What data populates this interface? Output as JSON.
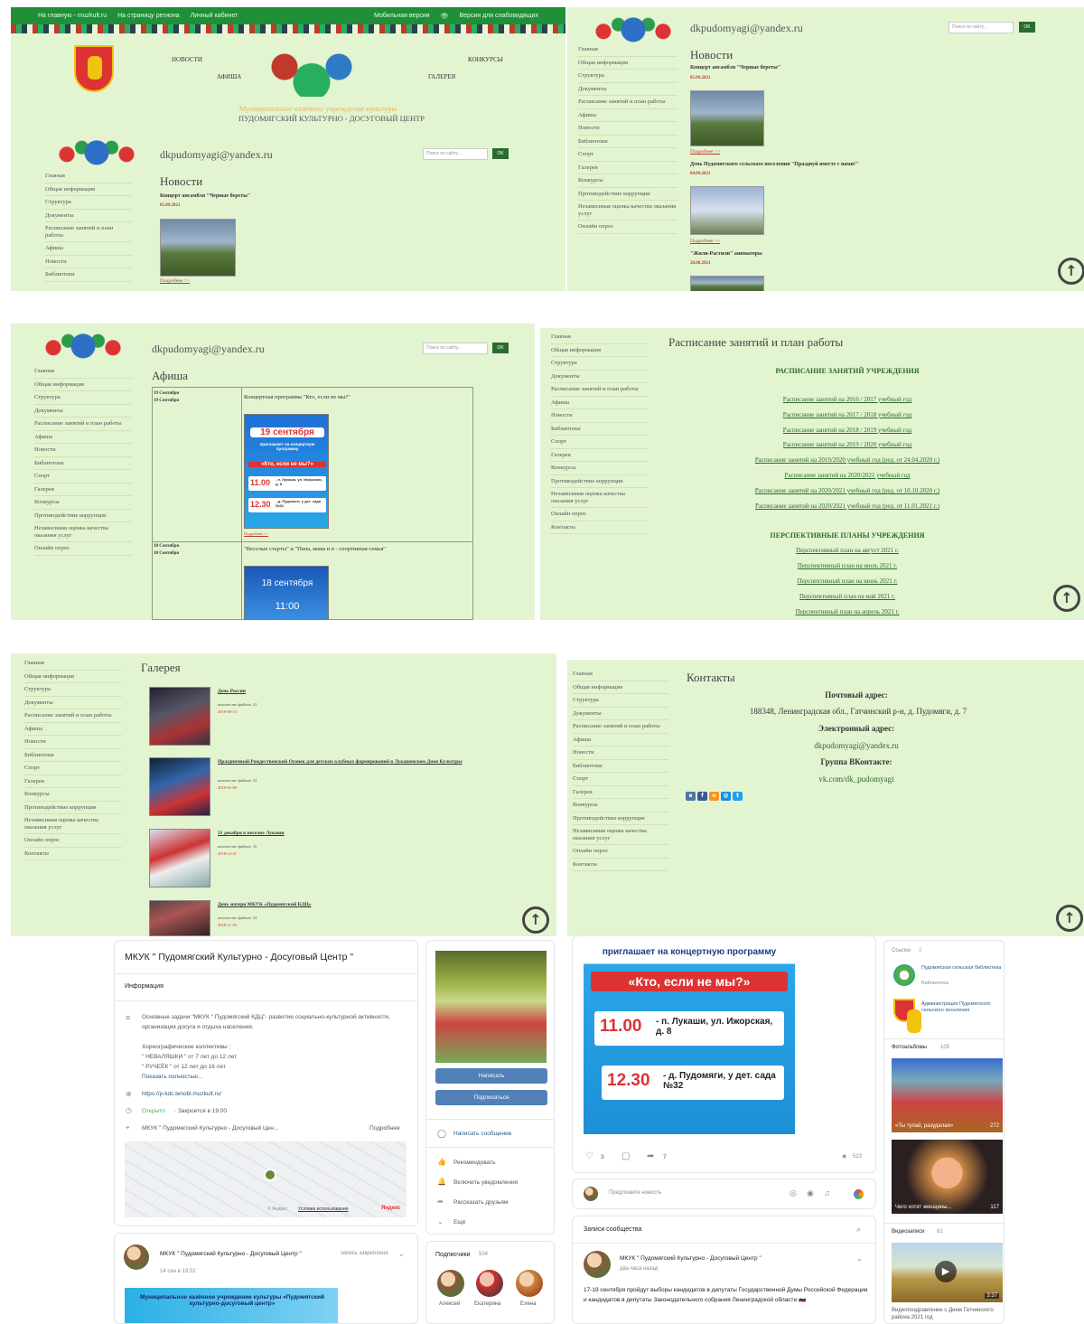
{
  "site": {
    "email": "dkpudomyagi@yandex.ru",
    "search_placeholder": "Поиск по сайту...",
    "ok": "OK",
    "more": "Подробнее >>",
    "org_line1": "Муниципальное казённое учреждение культуры",
    "org_line2": "ПУДОМЯГСКИЙ КУЛЬТУРНО - ДОСУГОВЫЙ ЦЕНТР",
    "topbar": [
      "На главную - muzkult.ru",
      "На страницу региона",
      "Личный кабинет"
    ],
    "topbar_right": [
      "Мобильная версия",
      "Версия для слабовидящих"
    ],
    "nav": {
      "news": "НОВОСТИ",
      "afisha": "АФИША",
      "konkursy": "КОНКУРСЫ",
      "gallery": "ГАЛЕРЕЯ"
    },
    "menu": [
      "Главная",
      "Общая информация",
      "Структура",
      "Документы",
      "Расписание занятий и план работы",
      "Афиша",
      "Новости",
      "Библиотеки",
      "Спорт",
      "Галерея",
      "Конкурсы",
      "Противодействие коррупции",
      "Независимая оценка качества оказания услуг",
      "Онлайн опрос",
      "Контакты"
    ]
  },
  "news": {
    "title": "Новости",
    "items": [
      {
        "title": "Концерт ансамбля \"Черные береты\"",
        "date": "05.09.2021"
      },
      {
        "title": "День Пудомягского сельского поселения \"Празднуй вместе с нами!\"",
        "date": "04.09.2021"
      },
      {
        "title": "\"Жили-Растили\" аниматоры",
        "date": "28.08.2021"
      }
    ]
  },
  "afisha": {
    "title": "Афиша",
    "events": [
      {
        "dates": [
          "19 Сентября",
          "19 Сентября"
        ],
        "title": "Концертная программа \"Кто, если не мы?\""
      },
      {
        "dates": [
          "18 Сентября",
          "18 Сентября"
        ],
        "title": "\"Веселые старты\" и \"Папа, мама и я - спортивная семья\""
      }
    ],
    "poster1": {
      "date": "19 сентября",
      "invite": "приглашает на концертную программу",
      "name": "«Кто, если не мы?»",
      "t1": "11.00",
      "p1": "- п. Лукаши, ул. Ижорская, д. 8",
      "t2": "12.30",
      "p2": "- д. Пудомяги, у дет. сада №32"
    },
    "poster2": {
      "date": "18 сентября",
      "time": "11:00"
    }
  },
  "schedule": {
    "title": "Расписание занятий и план работы",
    "heading1": "РАСПИСАНИЕ ЗАНЯТИЙ УЧРЕЖДЕНИЯ",
    "links": [
      "Расписание занятий на 2016 / 2017 учебный год",
      "Расписание занятий на 2017 / 2018 учебный год",
      "Расписание занятий на 2018 / 2019 учебный год",
      "Расписание занятий на 2019 / 2020 учебный год",
      "Расписание занятий на 2019/2020 учебный год (ред. от 24.04.2020 г.)",
      "Расписание занятий на 2020/2021 учебный год",
      "Расписание занятий на 2020/2021 учебный год (ред. от 10.10.2020 г.)",
      "Расписание занятий на 2020/2021 учебный год (ред. от 11.01.2021 г.)"
    ],
    "heading2": "ПЕРСПЕКТИВНЫЕ ПЛАНЫ УЧРЕЖДЕНИЯ",
    "plans": [
      "Перспективный план на август 2021 г.",
      "Перспективный план на июль 2021 г.",
      "Перспективный план на июнь 2021 г.",
      "Перспективный план на май 2021 г.",
      "Перспективный план на апрель 2021 г."
    ]
  },
  "gallery": {
    "title": "Галерея",
    "items": [
      {
        "title": "День России",
        "count": "количество файлов: 41",
        "date": "2019-06-13"
      },
      {
        "title": "Праздничный Рождественский Огонек для детских клубных формирований в Лукашевском Доме Культуры",
        "count": "количество файлов: 33",
        "date": "2019-01-09"
      },
      {
        "title": "31 декабря в поселке Лукаши",
        "count": "количество файлов: 16",
        "date": "2018-12-31"
      },
      {
        "title": "День матери МКУК «Пудомягский КДЦ»",
        "count": "количество файлов: 14",
        "date": "2018-11-29"
      }
    ]
  },
  "contacts": {
    "title": "Контакты",
    "postal_label": "Почтовый адрес:",
    "postal": "188348, Ленинградская обл., Гатчинский р-н, д. Пудомяги, д. 7",
    "email_label": "Электронный адрес:",
    "email": "dkpudomyagi@yandex.ru",
    "vk_label": "Группа ВКонтакте:",
    "vk": "vk.com/dk_pudomyagi"
  },
  "vk": {
    "name": "МКУК \" Пудомягский Культурно - Досуговый Центр \"",
    "info": "Информация",
    "desc1": "Основные задачи \"МКУК \" Пудомягский КДЦ\"- развитие социально-культурной активности, организация досуга и отдыха населения.",
    "desc2": "Хореографические коллективы :",
    "desc3": "\" НЕВАЛЯШКИ \" от 7 лет до 12 лет",
    "desc4": "\" РУЧЕЁК \" от 12 лет до 16 лет",
    "show_more": "Показать полностью...",
    "site": "https://p-kdc.lenobl.muzkult.ru/",
    "open": "Открыто",
    "closes": "· Закроется в 19:00",
    "address": "МКУК \" Пудомягский Культурно - Досуговый Цен...",
    "details": "Подробнее",
    "map_copy": "© Яндекс",
    "map_terms": "Условия использования",
    "map_brand": "Яндекс",
    "write": "Написать",
    "subscribe": "Подписаться",
    "actions": [
      "Написать сообщение",
      "Рекомендовать",
      "Включить уведомления",
      "Рассказать друзьям",
      "Ещё"
    ],
    "subscribers_label": "Подписчики",
    "subscribers_count": "504",
    "subscribers": [
      "Алексей",
      "Екатерина",
      "Елена"
    ],
    "pinned_author": "МКУК \" Пудомягский Культурно - Досуговый Центр \"",
    "pinned_suffix": "запись закреплена",
    "pinned_date": "14 сен в 19:52",
    "pinned_banner": "Муниципальное казённое учреждение культуры «Пудомягский культурно-досуговый центр»",
    "post_likes": "3",
    "post_shares": "7",
    "post_views": "523",
    "suggest": "Предложите новость",
    "community_posts": "Записи сообщества",
    "post2_author": "МКУК \" Пудомягский Культурно - Досуговый Центр \"",
    "post2_time": "два часа назад",
    "post2_text": "17-19 сентября пройдут выборы кандидатов в депутаты Государственной Думы Российской Федерации и кандидатов в депутаты Законодательного собрания Ленинградской области 🇷🇺",
    "links_label": "Ссылки",
    "links_count": "2",
    "link1": "Пудомягская сельская библиотека",
    "link1_sub": "Библиотека",
    "link2": "Администрация Пудомягского сельского поселения",
    "albums_label": "Фотоальбомы",
    "albums_count": "105",
    "album1": "«Ты тупай, разудалая»",
    "album1_count": "272",
    "album2": "Чего хотят женщины...",
    "album2_count": "117",
    "videos_label": "Видеозаписи",
    "videos_count": "61",
    "video_dur": "3:37",
    "video_title": "Видеопоздравление с Днем Гатчинского района 2021 год"
  },
  "colors": {
    "panel_bg": "#e3f4d1",
    "menu_text": "#555555",
    "date_red": "#c0392b",
    "link_green": "#2d6a2d",
    "vk_blue": "#5181b8"
  }
}
